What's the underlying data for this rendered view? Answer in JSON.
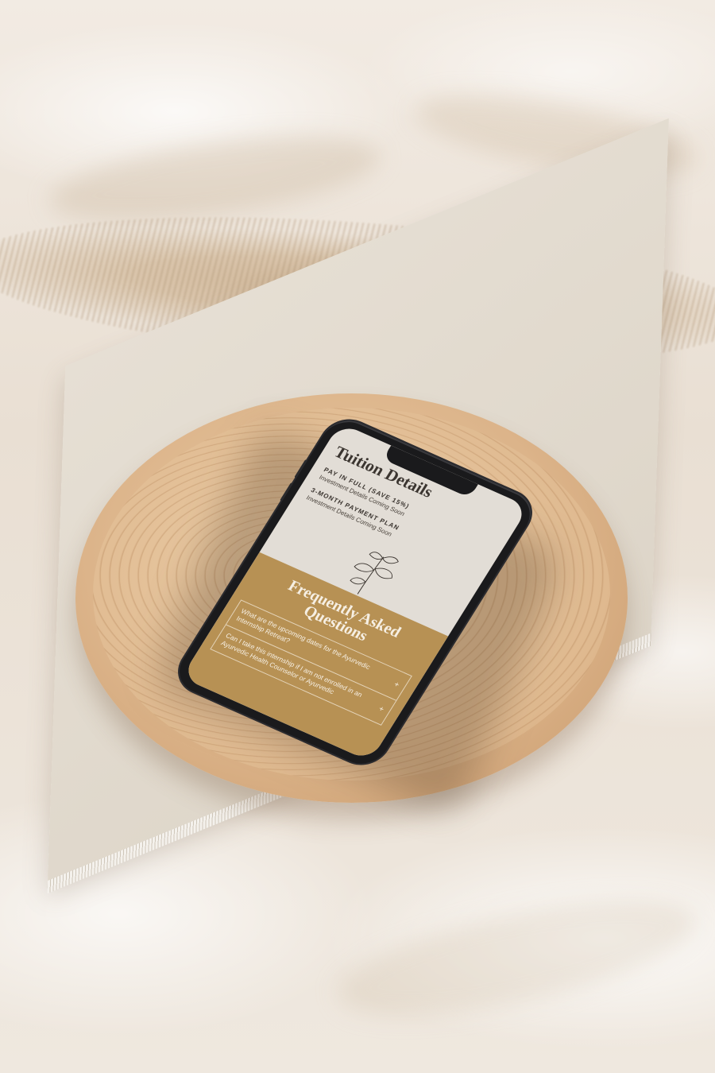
{
  "tuition": {
    "title": "Tuition Details",
    "plans": [
      {
        "name": "PAY IN FULL (SAVE 15%)",
        "detail": "Investment Details Coming Soon"
      },
      {
        "name": "3-MONTH PAYMENT PLAN",
        "detail": "Investment Details Coming Soon"
      }
    ]
  },
  "faq": {
    "title": "Frequently Asked Questions",
    "items": [
      {
        "question": "What are the upcoming dates for the Ayurvedic Internship Retreat?"
      },
      {
        "question": "Can I take this internship if I am not enrolled in an Ayurvedic Health Counselor or Ayurvedic"
      }
    ],
    "expand_symbol": "+"
  },
  "icons": {
    "decoration": "herb-leaf-icon"
  },
  "colors": {
    "accent": "#b79154",
    "screen_bg": "#e2ddd6",
    "text_dark": "#3b3530"
  }
}
